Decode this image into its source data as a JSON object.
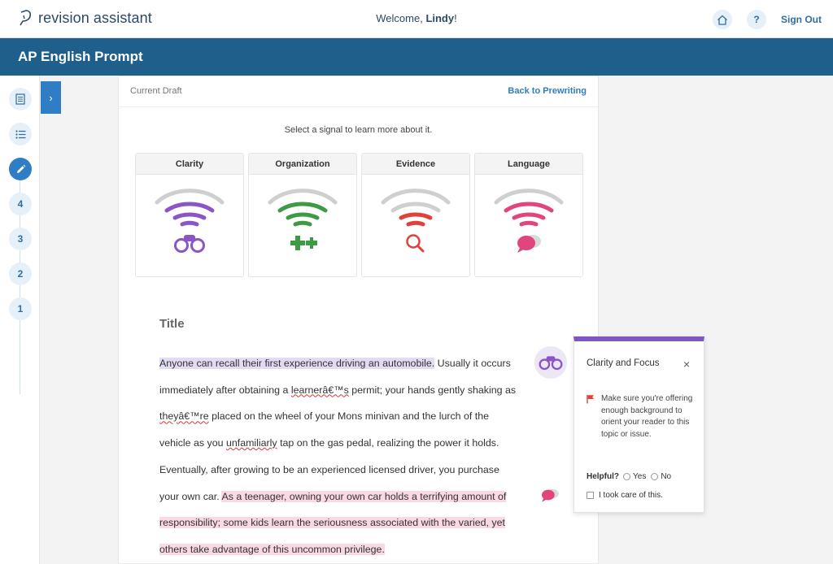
{
  "app": {
    "brand": "revision assistant",
    "welcome_prefix": "Welcome, ",
    "user_name": "Lindy",
    "welcome_suffix": "!",
    "help_label": "?",
    "sign_out": "Sign Out"
  },
  "prompt_title": "AP English Prompt",
  "stepper": {
    "steps": [
      "4",
      "3",
      "2",
      "1"
    ]
  },
  "expand_label": "›",
  "draft": {
    "current_label": "Current Draft",
    "back_link": "Back to Prewriting",
    "hint": "Select a signal to learn more about it."
  },
  "signals": [
    {
      "label": "Clarity",
      "color": "#8a55c6",
      "icon": "binoculars-icon",
      "level": "3 of 4 bars"
    },
    {
      "label": "Organization",
      "color": "#3e9a45",
      "icon": "puzzle-icon",
      "level": "3 of 4 bars"
    },
    {
      "label": "Evidence",
      "color": "#e0413a",
      "icon": "magnifier-icon",
      "level": "2 of 4 bars"
    },
    {
      "label": "Language",
      "color": "#e0457e",
      "icon": "speech-bubbles-icon",
      "level": "3 of 4 bars"
    }
  ],
  "essay": {
    "title": "Title",
    "s1_highlight": "Anyone can recall their first experience driving an automobile.",
    "s2a": " Usually it occurs immediately after obtaining a ",
    "learner": "learnerâ€™s",
    "s2b": " permit; your hands gently shaking as ",
    "theyre": "theyâ€™re",
    "s2c": " placed on the wheel of your Mons minivan and the lurch of the vehicle as you ",
    "unfamiliarly": "unfamiliarly",
    "s2d": " tap on the gas pedal, realizing the power it holds. Eventually, after growing to be an experienced licensed driver, you purchase your own car. ",
    "s3_highlight": "As a teenager, owning your own car holds a terrifying amount of responsibility; some kids learn the seriousness associated with the varied, yet others take advantage of this uncommon privilege."
  },
  "popup": {
    "accent": "#7e57c2",
    "title": "Clarity and Focus",
    "close": "×",
    "message": "Make sure you're offering enough background to orient your reader to this topic or issue.",
    "helpful_label": "Helpful?",
    "yes": "Yes",
    "no": "No",
    "took_care": "I took care of this."
  }
}
